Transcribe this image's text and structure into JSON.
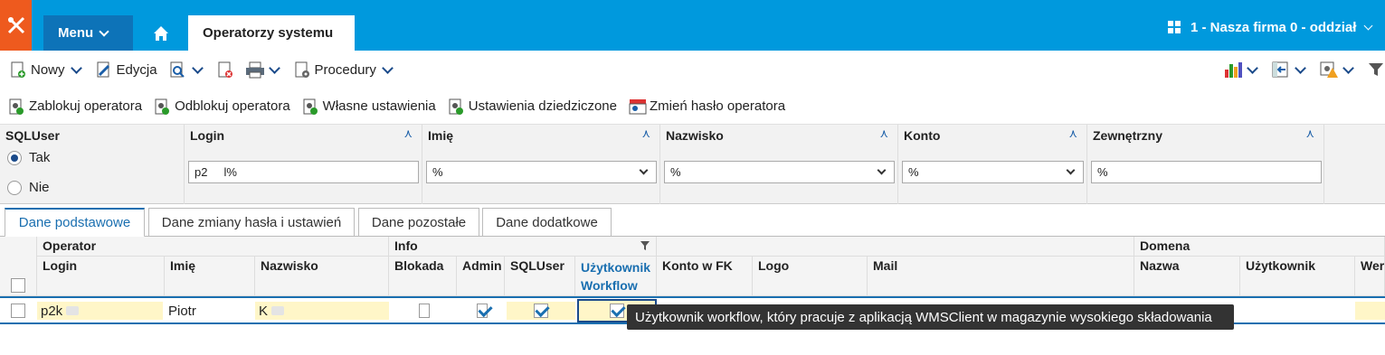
{
  "topbar": {
    "menu_label": "Menu",
    "active_tab": "Operatorzy systemu",
    "company": "1 - Nasza firma 0 - oddział"
  },
  "toolbar1": {
    "new_label": "Nowy",
    "edit_label": "Edycja",
    "procedures_label": "Procedury"
  },
  "toolbar2": {
    "lock": "Zablokuj operatora",
    "unlock": "Odblokuj operatora",
    "own_settings": "Własne ustawienia",
    "inherited_settings": "Ustawienia dziedziczone",
    "change_password": "Zmień hasło operatora"
  },
  "filters": {
    "sqluser_label": "SQLUser",
    "opt_yes": "Tak",
    "opt_no": "Nie",
    "selected": "Tak",
    "login_label": "Login",
    "login_value": "p2     l%",
    "imie_label": "Imię",
    "imie_value": "%",
    "nazwisko_label": "Nazwisko",
    "nazwisko_value": "%",
    "konto_label": "Konto",
    "konto_value": "%",
    "zewnetrzny_label": "Zewnętrzny",
    "zewnetrzny_value": "%"
  },
  "subtabs": [
    "Dane podstawowe",
    "Dane zmiany hasła i ustawień",
    "Dane pozostałe",
    "Dane dodatkowe"
  ],
  "grid": {
    "group_operator": "Operator",
    "group_info": "Info",
    "group_domena": "Domena",
    "columns": {
      "login": "Login",
      "imie": "Imię",
      "nazwisko": "Nazwisko",
      "blokada": "Blokada",
      "admin": "Admin",
      "sqluser": "SQLUser",
      "uzytkownik_wf_1": "Użytkownik",
      "uzytkownik_wf_2": "Workflow",
      "konto_fk": "Konto w FK",
      "logo": "Logo",
      "mail": "Mail",
      "dom_nazwa": "Nazwa",
      "dom_uzytkownik": "Użytkownik",
      "wer": "Wer"
    },
    "rows": [
      {
        "login": "p2k",
        "imie": "Piotr",
        "nazwisko": "K",
        "blokada": false,
        "admin": true,
        "sqluser": true,
        "workflow": true
      }
    ]
  },
  "tooltip": "Użytkownik workflow, który pracuje z aplikacją WMSClient w magazynie wysokiego składowania"
}
